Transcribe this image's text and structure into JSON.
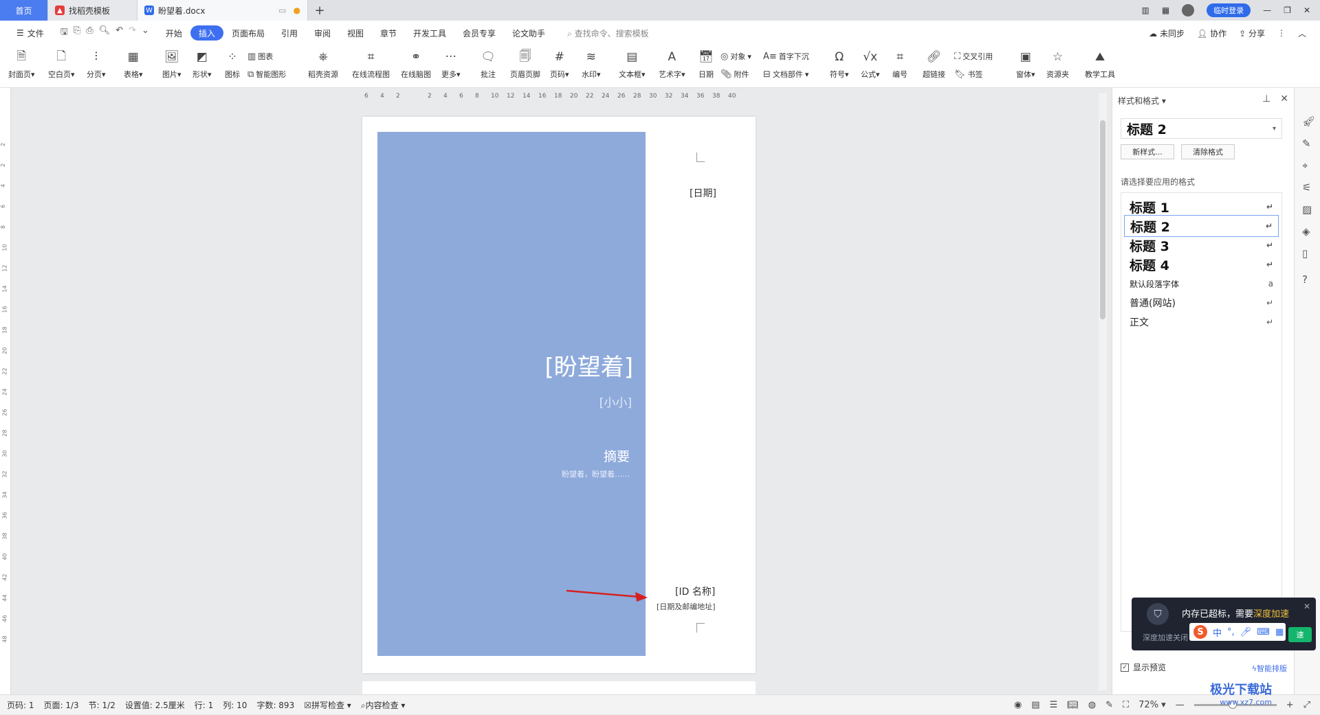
{
  "tabs": {
    "home": "首页",
    "template": "找稻壳模板",
    "doc": "盼望着.docx",
    "login": "临时登录"
  },
  "menu": {
    "file": "文件",
    "items": [
      "开始",
      "插入",
      "页面布局",
      "引用",
      "审阅",
      "视图",
      "章节",
      "开发工具",
      "会员专享",
      "论文助手"
    ],
    "active_index": 1,
    "search_placeholder": "查找命令、搜索模板",
    "sync": "未同步",
    "collab": "协作",
    "share": "分享"
  },
  "ribbon": {
    "cover": "封面页",
    "blank": "空白页",
    "pagebreak": "分页",
    "table": "表格",
    "picture": "图片",
    "shape": "形状",
    "icon": "图标",
    "chart": "图表",
    "smartart": "智能图形",
    "docer": "稻壳资源",
    "flowchart": "在线流程图",
    "mindmap": "在线脑图",
    "more": "更多",
    "comment": "批注",
    "header_footer": "页眉页脚",
    "page_num": "页码",
    "watermark": "水印",
    "textbox": "文本框",
    "wordart": "艺术字",
    "date": "日期",
    "object": "对象",
    "attachment": "附件",
    "dropcap": "首字下沉",
    "docparts": "文档部件",
    "symbol": "符号",
    "formula": "公式",
    "numbering": "编号",
    "hyperlink": "超链接",
    "crossref": "交叉引用",
    "bookmark": "书签",
    "window": "窗体",
    "resources": "资源夹",
    "teaching": "教学工具"
  },
  "ruler": {
    "h": [
      "6",
      "4",
      "2",
      "",
      "2",
      "4",
      "6",
      "8",
      "10",
      "12",
      "14",
      "16",
      "18",
      "20",
      "22",
      "24",
      "26",
      "28",
      "30",
      "32",
      "34",
      "36",
      "38",
      "40"
    ],
    "v": [
      "2",
      "2",
      "4",
      "6",
      "8",
      "10",
      "12",
      "14",
      "16",
      "18",
      "20",
      "22",
      "24",
      "26",
      "28",
      "30",
      "32",
      "34",
      "36",
      "38",
      "40",
      "42",
      "44",
      "46",
      "48"
    ]
  },
  "document": {
    "date": "[日期]",
    "title": "[盼望着]",
    "subtitle": "[小小]",
    "abstract_heading": "摘要",
    "abstract_text": "盼望着，盼望着……",
    "id_name": "[ID 名称]",
    "id_address": "[日期及邮编地址]",
    "panel_color": "#8eaadb"
  },
  "side_panel": {
    "header": "样式和格式",
    "current_style": "标题  2",
    "new_style": "新样式...",
    "clear_format": "清除格式",
    "choose_label": "请选择要应用的格式",
    "styles": [
      {
        "name": "标题  1",
        "kind": "h"
      },
      {
        "name": "标题  2",
        "kind": "h"
      },
      {
        "name": "标题  3",
        "kind": "h"
      },
      {
        "name": "标题  4",
        "kind": "h"
      },
      {
        "name": "默认段落字体",
        "kind": "s"
      },
      {
        "name": "普通(网站)",
        "kind": "n"
      },
      {
        "name": "正文",
        "kind": "n"
      }
    ],
    "selected_index": 1,
    "show_preview": "显示预览",
    "smart_layout": "智能排版"
  },
  "popup": {
    "message_prefix": "内存已超标，需要",
    "message_highlight": "深度加速",
    "sub": "深度加速关闭",
    "speed": "速"
  },
  "ime": {
    "lang": "中"
  },
  "status": {
    "page_num": "页码: 1",
    "pages": "页面: 1/3",
    "section": "节: 1/2",
    "setting": "设置值: 2.5厘米",
    "row": "行: 1",
    "col": "列: 10",
    "words": "字数: 893",
    "spell": "拼写检查",
    "content_check": "内容检查",
    "zoom": "72%"
  },
  "watermark": {
    "brand": "极光下载站",
    "url": "www.xz7.com"
  }
}
